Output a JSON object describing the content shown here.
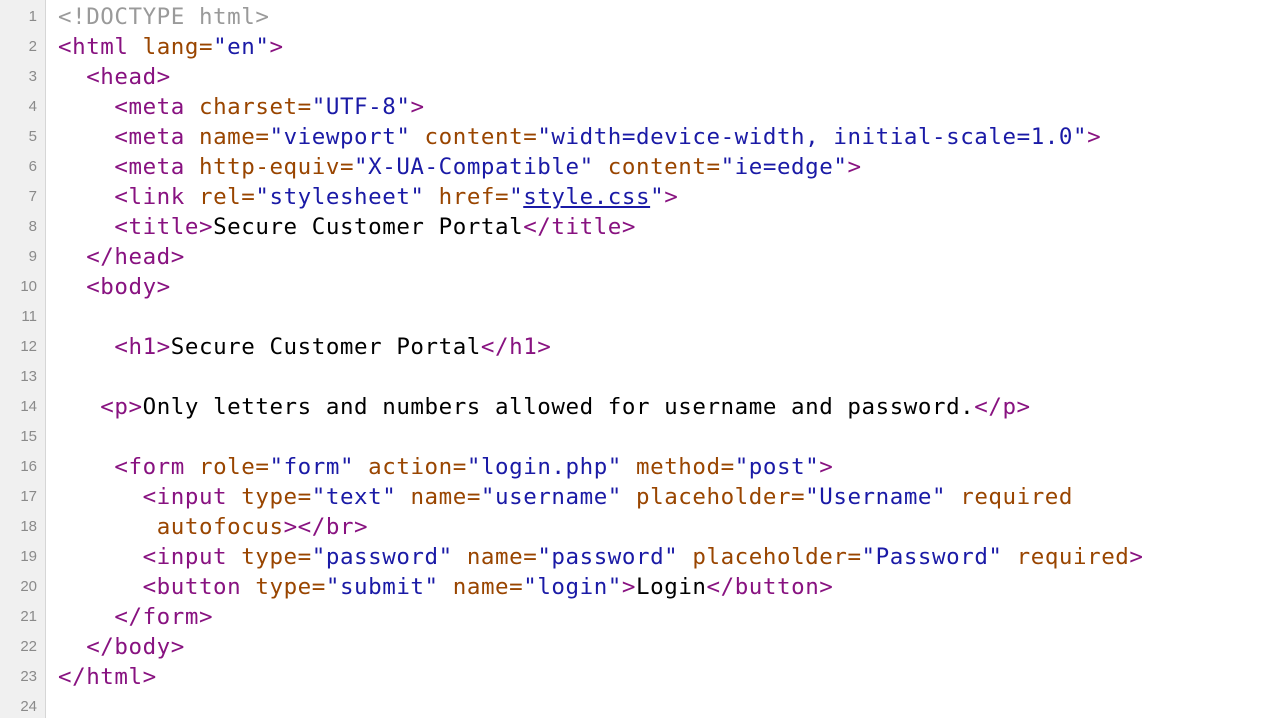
{
  "colors": {
    "doctype": "#9a9a9a",
    "tag": "#881280",
    "attribute": "#994500",
    "string": "#1a1aa6",
    "text": "#000000",
    "gutter_bg": "#f0f0f0",
    "line_number": "#8a8a8a"
  },
  "lines": [
    {
      "n": "1",
      "tokens": [
        {
          "k": "doctype",
          "t": "<!DOCTYPE html>"
        }
      ]
    },
    {
      "n": "2",
      "tokens": [
        {
          "k": "tag",
          "t": "<html"
        },
        {
          "k": "text",
          "t": " "
        },
        {
          "k": "attr",
          "t": "lang="
        },
        {
          "k": "str",
          "t": "\"en\""
        },
        {
          "k": "tag",
          "t": ">"
        }
      ]
    },
    {
      "n": "3",
      "tokens": [
        {
          "k": "text",
          "t": "  "
        },
        {
          "k": "tag",
          "t": "<head>"
        }
      ]
    },
    {
      "n": "4",
      "tokens": [
        {
          "k": "text",
          "t": "    "
        },
        {
          "k": "tag",
          "t": "<meta"
        },
        {
          "k": "text",
          "t": " "
        },
        {
          "k": "attr",
          "t": "charset="
        },
        {
          "k": "str",
          "t": "\"UTF-8\""
        },
        {
          "k": "tag",
          "t": ">"
        }
      ]
    },
    {
      "n": "5",
      "tokens": [
        {
          "k": "text",
          "t": "    "
        },
        {
          "k": "tag",
          "t": "<meta"
        },
        {
          "k": "text",
          "t": " "
        },
        {
          "k": "attr",
          "t": "name="
        },
        {
          "k": "str",
          "t": "\"viewport\""
        },
        {
          "k": "text",
          "t": " "
        },
        {
          "k": "attr",
          "t": "content="
        },
        {
          "k": "str",
          "t": "\"width=device-width, initial-scale=1.0\""
        },
        {
          "k": "tag",
          "t": ">"
        }
      ]
    },
    {
      "n": "6",
      "tokens": [
        {
          "k": "text",
          "t": "    "
        },
        {
          "k": "tag",
          "t": "<meta"
        },
        {
          "k": "text",
          "t": " "
        },
        {
          "k": "attr",
          "t": "http-equiv="
        },
        {
          "k": "str",
          "t": "\"X-UA-Compatible\""
        },
        {
          "k": "text",
          "t": " "
        },
        {
          "k": "attr",
          "t": "content="
        },
        {
          "k": "str",
          "t": "\"ie=edge\""
        },
        {
          "k": "tag",
          "t": ">"
        }
      ]
    },
    {
      "n": "7",
      "tokens": [
        {
          "k": "text",
          "t": "    "
        },
        {
          "k": "tag",
          "t": "<link"
        },
        {
          "k": "text",
          "t": " "
        },
        {
          "k": "attr",
          "t": "rel="
        },
        {
          "k": "str",
          "t": "\"stylesheet\""
        },
        {
          "k": "text",
          "t": " "
        },
        {
          "k": "attr",
          "t": "href="
        },
        {
          "k": "str",
          "t": "\""
        },
        {
          "k": "link",
          "t": "style.css"
        },
        {
          "k": "str",
          "t": "\""
        },
        {
          "k": "tag",
          "t": ">"
        }
      ]
    },
    {
      "n": "8",
      "tokens": [
        {
          "k": "text",
          "t": "    "
        },
        {
          "k": "tag",
          "t": "<title>"
        },
        {
          "k": "text",
          "t": "Secure Customer Portal"
        },
        {
          "k": "tag",
          "t": "</title>"
        }
      ]
    },
    {
      "n": "9",
      "tokens": [
        {
          "k": "text",
          "t": "  "
        },
        {
          "k": "tag",
          "t": "</head>"
        }
      ]
    },
    {
      "n": "10",
      "tokens": [
        {
          "k": "text",
          "t": "  "
        },
        {
          "k": "tag",
          "t": "<body>"
        }
      ]
    },
    {
      "n": "11",
      "tokens": []
    },
    {
      "n": "12",
      "tokens": [
        {
          "k": "text",
          "t": "    "
        },
        {
          "k": "tag",
          "t": "<h1>"
        },
        {
          "k": "text",
          "t": "Secure Customer Portal"
        },
        {
          "k": "tag",
          "t": "</h1>"
        }
      ]
    },
    {
      "n": "13",
      "tokens": []
    },
    {
      "n": "14",
      "tokens": [
        {
          "k": "text",
          "t": "   "
        },
        {
          "k": "tag",
          "t": "<p>"
        },
        {
          "k": "text",
          "t": "Only letters and numbers allowed for username and password."
        },
        {
          "k": "tag",
          "t": "</p>"
        }
      ]
    },
    {
      "n": "15",
      "tokens": []
    },
    {
      "n": "16",
      "tokens": [
        {
          "k": "text",
          "t": "    "
        },
        {
          "k": "tag",
          "t": "<form"
        },
        {
          "k": "text",
          "t": " "
        },
        {
          "k": "attr",
          "t": "role="
        },
        {
          "k": "str",
          "t": "\"form\""
        },
        {
          "k": "text",
          "t": " "
        },
        {
          "k": "attr",
          "t": "action="
        },
        {
          "k": "str",
          "t": "\"login.php\""
        },
        {
          "k": "text",
          "t": " "
        },
        {
          "k": "attr",
          "t": "method="
        },
        {
          "k": "str",
          "t": "\"post\""
        },
        {
          "k": "tag",
          "t": ">"
        }
      ]
    },
    {
      "n": "17",
      "tokens": [
        {
          "k": "text",
          "t": "      "
        },
        {
          "k": "tag",
          "t": "<input"
        },
        {
          "k": "text",
          "t": " "
        },
        {
          "k": "attr",
          "t": "type="
        },
        {
          "k": "str",
          "t": "\"text\""
        },
        {
          "k": "text",
          "t": " "
        },
        {
          "k": "attr",
          "t": "name="
        },
        {
          "k": "str",
          "t": "\"username\""
        },
        {
          "k": "text",
          "t": " "
        },
        {
          "k": "attr",
          "t": "placeholder="
        },
        {
          "k": "str",
          "t": "\"Username\""
        },
        {
          "k": "text",
          "t": " "
        },
        {
          "k": "attr",
          "t": "required"
        }
      ]
    },
    {
      "n": "18",
      "tokens": [
        {
          "k": "text",
          "t": "       "
        },
        {
          "k": "attr",
          "t": "autofocus"
        },
        {
          "k": "tag",
          "t": ">"
        },
        {
          "k": "tag",
          "t": "</br>"
        }
      ]
    },
    {
      "n": "19",
      "tokens": [
        {
          "k": "text",
          "t": "      "
        },
        {
          "k": "tag",
          "t": "<input"
        },
        {
          "k": "text",
          "t": " "
        },
        {
          "k": "attr",
          "t": "type="
        },
        {
          "k": "str",
          "t": "\"password\""
        },
        {
          "k": "text",
          "t": " "
        },
        {
          "k": "attr",
          "t": "name="
        },
        {
          "k": "str",
          "t": "\"password\""
        },
        {
          "k": "text",
          "t": " "
        },
        {
          "k": "attr",
          "t": "placeholder="
        },
        {
          "k": "str",
          "t": "\"Password\""
        },
        {
          "k": "text",
          "t": " "
        },
        {
          "k": "attr",
          "t": "required"
        },
        {
          "k": "tag",
          "t": ">"
        }
      ]
    },
    {
      "n": "20",
      "tokens": [
        {
          "k": "text",
          "t": "      "
        },
        {
          "k": "tag",
          "t": "<button"
        },
        {
          "k": "text",
          "t": " "
        },
        {
          "k": "attr",
          "t": "type="
        },
        {
          "k": "str",
          "t": "\"submit\""
        },
        {
          "k": "text",
          "t": " "
        },
        {
          "k": "attr",
          "t": "name="
        },
        {
          "k": "str",
          "t": "\"login\""
        },
        {
          "k": "tag",
          "t": ">"
        },
        {
          "k": "text",
          "t": "Login"
        },
        {
          "k": "tag",
          "t": "</button>"
        }
      ]
    },
    {
      "n": "21",
      "tokens": [
        {
          "k": "text",
          "t": "    "
        },
        {
          "k": "tag",
          "t": "</form>"
        }
      ]
    },
    {
      "n": "22",
      "tokens": [
        {
          "k": "text",
          "t": "  "
        },
        {
          "k": "tag",
          "t": "</body>"
        }
      ]
    },
    {
      "n": "23",
      "tokens": [
        {
          "k": "tag",
          "t": "</html>"
        }
      ]
    },
    {
      "n": "24",
      "tokens": []
    }
  ]
}
